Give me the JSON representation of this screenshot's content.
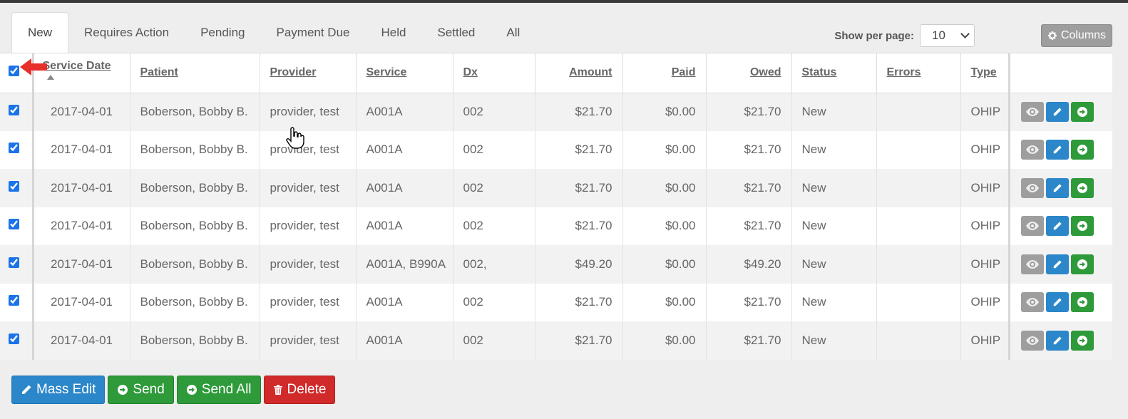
{
  "tabs": [
    {
      "label": "New",
      "active": true
    },
    {
      "label": "Requires Action"
    },
    {
      "label": "Pending"
    },
    {
      "label": "Payment Due"
    },
    {
      "label": "Held"
    },
    {
      "label": "Settled"
    },
    {
      "label": "All"
    }
  ],
  "per_page": {
    "label": "Show per page:",
    "value": "10"
  },
  "columns_button": {
    "label": "Columns",
    "icon": "gear-icon"
  },
  "table": {
    "headers": {
      "service_date": "Service Date",
      "patient": "Patient",
      "provider": "Provider",
      "service": "Service",
      "dx": "Dx",
      "amount": "Amount",
      "paid": "Paid",
      "owed": "Owed",
      "status": "Status",
      "errors": "Errors",
      "type": "Type"
    },
    "sorted_column": "service_date",
    "sort_direction": "asc",
    "rows": [
      {
        "checked": true,
        "service_date": "2017-04-01",
        "patient": "Boberson, Bobby B.",
        "provider": "provider, test",
        "service": "A001A",
        "dx": "002",
        "amount": "$21.70",
        "paid": "$0.00",
        "owed": "$21.70",
        "status": "New",
        "errors": "",
        "type": "OHIP"
      },
      {
        "checked": true,
        "service_date": "2017-04-01",
        "patient": "Boberson, Bobby B.",
        "provider": "provider, test",
        "service": "A001A",
        "dx": "002",
        "amount": "$21.70",
        "paid": "$0.00",
        "owed": "$21.70",
        "status": "New",
        "errors": "",
        "type": "OHIP"
      },
      {
        "checked": true,
        "service_date": "2017-04-01",
        "patient": "Boberson, Bobby B.",
        "provider": "provider, test",
        "service": "A001A",
        "dx": "002",
        "amount": "$21.70",
        "paid": "$0.00",
        "owed": "$21.70",
        "status": "New",
        "errors": "",
        "type": "OHIP"
      },
      {
        "checked": true,
        "service_date": "2017-04-01",
        "patient": "Boberson, Bobby B.",
        "provider": "provider, test",
        "service": "A001A",
        "dx": "002",
        "amount": "$21.70",
        "paid": "$0.00",
        "owed": "$21.70",
        "status": "New",
        "errors": "",
        "type": "OHIP"
      },
      {
        "checked": true,
        "service_date": "2017-04-01",
        "patient": "Boberson, Bobby B.",
        "provider": "provider, test",
        "service": "A001A, B990A",
        "dx": "002,",
        "amount": "$49.20",
        "paid": "$0.00",
        "owed": "$49.20",
        "status": "New",
        "errors": "",
        "type": "OHIP"
      },
      {
        "checked": true,
        "service_date": "2017-04-01",
        "patient": "Boberson, Bobby B.",
        "provider": "provider, test",
        "service": "A001A",
        "dx": "002",
        "amount": "$21.70",
        "paid": "$0.00",
        "owed": "$21.70",
        "status": "New",
        "errors": "",
        "type": "OHIP"
      },
      {
        "checked": true,
        "service_date": "2017-04-01",
        "patient": "Boberson, Bobby B.",
        "provider": "provider, test",
        "service": "A001A",
        "dx": "002",
        "amount": "$21.70",
        "paid": "$0.00",
        "owed": "$21.70",
        "status": "New",
        "errors": "",
        "type": "OHIP"
      }
    ]
  },
  "bottom_buttons": {
    "mass_edit": "Mass Edit",
    "send": "Send",
    "send_all": "Send All",
    "delete": "Delete"
  },
  "colors": {
    "primary": "#2b87c9",
    "success": "#2e9a3a",
    "danger": "#d02a2a",
    "default": "#9e9e9e",
    "annotation_arrow": "#e8302a"
  }
}
